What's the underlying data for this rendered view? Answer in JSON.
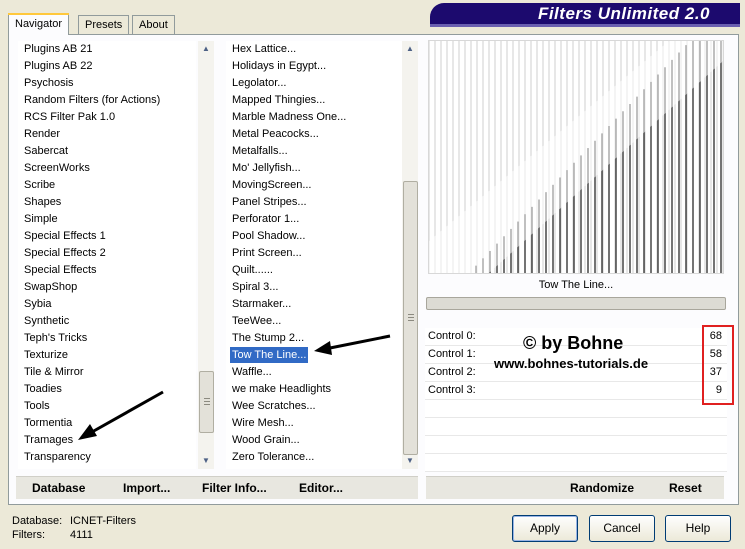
{
  "app": {
    "title": "Filters Unlimited 2.0"
  },
  "tabs": [
    {
      "label": "Navigator",
      "active": true
    },
    {
      "label": "Presets",
      "active": false
    },
    {
      "label": "About",
      "active": false
    }
  ],
  "categories": [
    "Plugins AB 21",
    "Plugins AB 22",
    "Psychosis",
    "Random Filters (for Actions)",
    "RCS Filter Pak 1.0",
    "Render",
    "Sabercat",
    "ScreenWorks",
    "Scribe",
    "Shapes",
    "Simple",
    "Special Effects 1",
    "Special Effects 2",
    "Special Effects",
    "SwapShop",
    "Sybia",
    "Synthetic",
    "Teph's Tricks",
    "Texturize",
    "Tile & Mirror",
    "Toadies",
    "Tools",
    "Tormentia",
    "Tramages",
    "Transparency"
  ],
  "filters": [
    "Hex Lattice...",
    "Holidays in Egypt...",
    "Legolator...",
    "Mapped Thingies...",
    "Marble Madness One...",
    "Metal Peacocks...",
    "Metalfalls...",
    "Mo' Jellyfish...",
    "MovingScreen...",
    "Panel Stripes...",
    "Perforator 1...",
    "Pool Shadow...",
    "Print Screen...",
    "Quilt......",
    "Spiral 3...",
    "Starmaker...",
    "TeeWee...",
    "The Stump 2...",
    "Tow The Line...",
    "Waffle...",
    "we make Headlights",
    "Wee Scratches...",
    "Wire Mesh...",
    "Wood Grain...",
    "Zero Tolerance..."
  ],
  "selected_filter": "Tow The Line...",
  "preview": {
    "filter_name": "Tow The Line..."
  },
  "controls": [
    {
      "label": "Control 0:",
      "value": "68"
    },
    {
      "label": "Control 1:",
      "value": "58"
    },
    {
      "label": "Control 2:",
      "value": "37"
    },
    {
      "label": "Control 3:",
      "value": "9"
    }
  ],
  "watermark": {
    "line1": "© by Bohne",
    "line2": "www.bohnes-tutorials.de"
  },
  "bottom_links": {
    "database": "Database",
    "import": "Import...",
    "filter_info": "Filter Info...",
    "editor": "Editor...",
    "randomize": "Randomize",
    "reset": "Reset"
  },
  "status": {
    "database_label": "Database:",
    "database_value": "ICNET-Filters",
    "filters_label": "Filters:",
    "filters_value": "4111"
  },
  "buttons": {
    "apply": "Apply",
    "cancel": "Cancel",
    "help": "Help"
  },
  "colors": {
    "banner": "#1c0a6e",
    "selection": "#316ac5",
    "highlight_box": "#e02020"
  }
}
